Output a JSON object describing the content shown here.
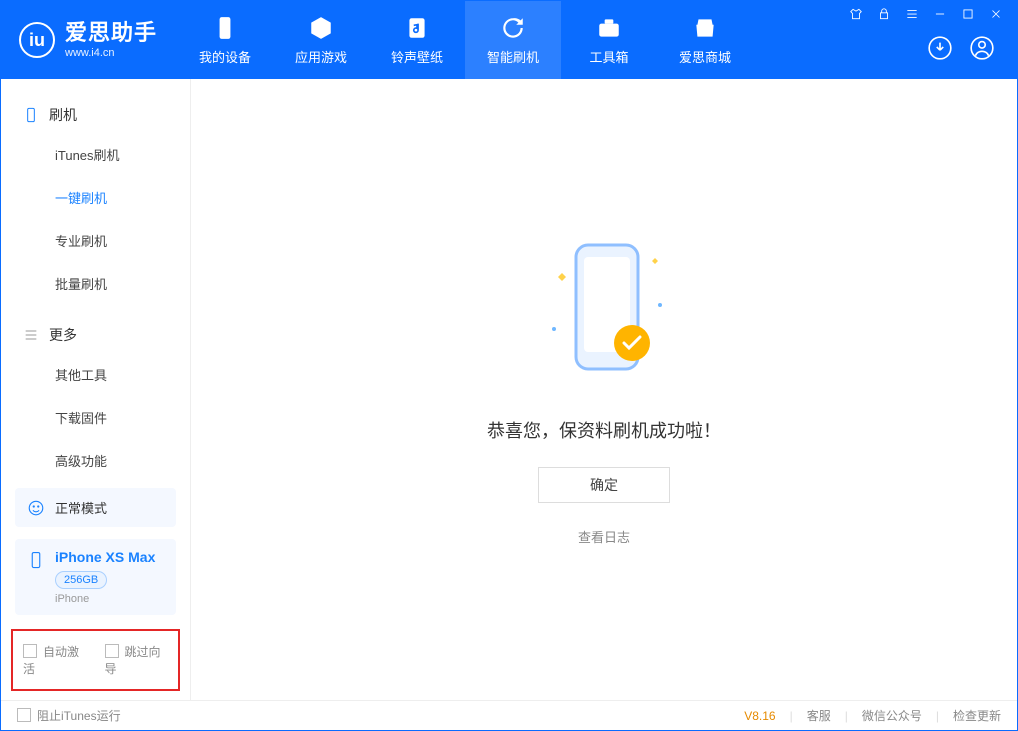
{
  "app": {
    "title": "爱思助手",
    "subtitle": "www.i4.cn"
  },
  "tabs": {
    "device": "我的设备",
    "apps": "应用游戏",
    "rings": "铃声壁纸",
    "flash": "智能刷机",
    "tools": "工具箱",
    "store": "爱思商城"
  },
  "sidebar": {
    "section_flash": "刷机",
    "items": {
      "itunes": "iTunes刷机",
      "oneclick": "一键刷机",
      "pro": "专业刷机",
      "batch": "批量刷机"
    },
    "section_more": "更多",
    "more_items": {
      "other": "其他工具",
      "firmware": "下载固件",
      "adv": "高级功能"
    },
    "mode_label": "正常模式",
    "device": {
      "name": "iPhone XS Max",
      "storage": "256GB",
      "type": "iPhone"
    },
    "check_auto": "自动激活",
    "check_skip": "跳过向导"
  },
  "main": {
    "success": "恭喜您，保资料刷机成功啦！",
    "ok": "确定",
    "log": "查看日志"
  },
  "footer": {
    "block_itunes": "阻止iTunes运行",
    "version": "V8.16",
    "service": "客服",
    "wechat": "微信公众号",
    "update": "检查更新"
  }
}
